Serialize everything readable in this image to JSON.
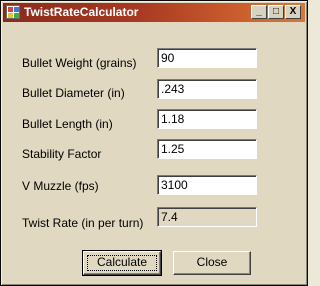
{
  "window": {
    "title": "TwistRateCalculator",
    "buttons": {
      "minimize": "_",
      "maximize": "□",
      "close": "X"
    }
  },
  "form": {
    "bullet_weight": {
      "label": "Bullet Weight (grains)",
      "value": "90"
    },
    "bullet_diameter": {
      "label": "Bullet Diameter (in)",
      "value": ".243"
    },
    "bullet_length": {
      "label": "Bullet Length (in)",
      "value": "1.18"
    },
    "stability_factor": {
      "label": "Stability Factor",
      "value": "1.25"
    },
    "v_muzzle": {
      "label": "V Muzzle (fps)",
      "value": "3100"
    },
    "twist_rate": {
      "label": "Twist Rate (in per turn)",
      "value": "7.4"
    }
  },
  "actions": {
    "calculate": "Calculate",
    "close": "Close"
  }
}
